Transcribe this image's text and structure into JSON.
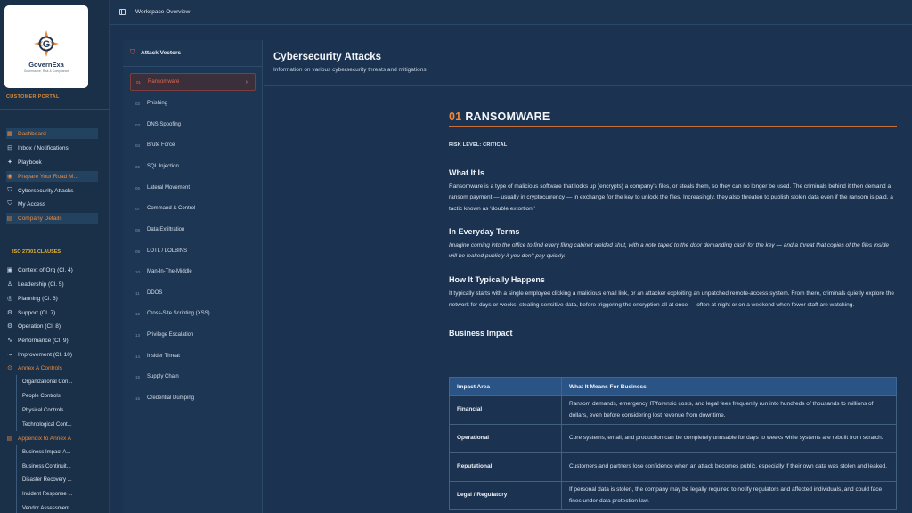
{
  "brand": {
    "name": "GovernExa",
    "tagline": "Governance, Risk & Compliance"
  },
  "sidebar": {
    "portal_label": "CUSTOMER PORTAL",
    "items": [
      {
        "label": "Dashboard",
        "icon": "dashboard-icon"
      },
      {
        "label": "Inbox / Notifications",
        "icon": "inbox-icon"
      },
      {
        "label": "Playbook",
        "icon": "playbook-icon"
      },
      {
        "label": "Prepare Your Road M...",
        "icon": "roadmap-icon"
      },
      {
        "label": "Cybersecurity Attacks",
        "icon": "shield-icon"
      },
      {
        "label": "My Access",
        "icon": "access-icon"
      },
      {
        "label": "Company Details",
        "icon": "building-icon"
      }
    ],
    "iso_label": "ISO 27001 CLAUSES",
    "clauses": [
      {
        "label": "Context of Org (Cl. 4)",
        "icon": "context-icon"
      },
      {
        "label": "Leadership (Cl. 5)",
        "icon": "leadership-icon"
      },
      {
        "label": "Planning (Cl. 6)",
        "icon": "planning-icon"
      },
      {
        "label": "Support (Cl. 7)",
        "icon": "support-icon"
      },
      {
        "label": "Operation (Cl. 8)",
        "icon": "operation-icon"
      },
      {
        "label": "Performance (Cl. 9)",
        "icon": "performance-icon"
      },
      {
        "label": "Improvement (Cl. 10)",
        "icon": "improvement-icon"
      },
      {
        "label": "Annex A Controls",
        "icon": "annex-icon"
      }
    ],
    "annex_sub": [
      "Organizational Con...",
      "People Controls",
      "Physical Controls",
      "Technological Cont..."
    ],
    "appendix_label": "Appendix to Annex A",
    "appendix_sub": [
      "Business Impact A...",
      "Business Continuit...",
      "Disaster Recovery ...",
      "Incident Response ...",
      "Vendor Assessment"
    ]
  },
  "topbar": {
    "title": "Workspace Overview"
  },
  "vectors": {
    "title": "Attack Vectors",
    "items": [
      {
        "num": "01",
        "label": "Ransomware"
      },
      {
        "num": "02",
        "label": "Phishing"
      },
      {
        "num": "03",
        "label": "DNS Spoofing"
      },
      {
        "num": "04",
        "label": "Brute Force"
      },
      {
        "num": "05",
        "label": "SQL Injection"
      },
      {
        "num": "06",
        "label": "Lateral Movement"
      },
      {
        "num": "07",
        "label": "Command & Control"
      },
      {
        "num": "08",
        "label": "Data Exfiltration"
      },
      {
        "num": "09",
        "label": "LOTL / LOLBINS"
      },
      {
        "num": "10",
        "label": "Man-In-The-Middle"
      },
      {
        "num": "11",
        "label": "DDOS"
      },
      {
        "num": "12",
        "label": "Cross-Site Scripting (XSS)"
      },
      {
        "num": "13",
        "label": "Privilege Escalation"
      },
      {
        "num": "14",
        "label": "Insider Threat"
      },
      {
        "num": "15",
        "label": "Supply Chain"
      },
      {
        "num": "16",
        "label": "Credential Dumping"
      }
    ]
  },
  "main": {
    "title": "Cybersecurity Attacks",
    "subtitle": "Information on various cybersecurity threats and mitigations",
    "article": {
      "num": "01",
      "title": "RANSOMWARE",
      "risk": "RISK LEVEL: CRITICAL",
      "what_heading": "What It Is",
      "what_text": "Ransomware is a type of malicious software that locks up (encrypts) a company's files, or steals them, so they can no longer be used. The criminals behind it then demand a ransom payment — usually in cryptocurrency — in exchange for the key to unlock the files. Increasingly, they also threaten to publish stolen data even if the ransom is paid, a tactic known as 'double extortion.'",
      "everyday_heading": "In Everyday Terms",
      "everyday_text": "Imagine coming into the office to find every filing cabinet welded shut, with a note taped to the door demanding cash for the key — and a threat that copies of the files inside will be leaked publicly if you don't pay quickly.",
      "how_heading": "How It Typically Happens",
      "how_text": "It typically starts with a single employee clicking a malicious email link, or an attacker exploiting an unpatched remote-access system. From there, criminals quietly explore the network for days or weeks, stealing sensitive data, before triggering the encryption all at once — often at night or on a weekend when fewer staff are watching.",
      "impact_heading": "Business Impact",
      "impact_cols": [
        "Impact Area",
        "What It Means For Business"
      ],
      "impact_rows": [
        {
          "area": "Financial",
          "text": "Ransom demands, emergency IT/forensic costs, and legal fees frequently run into hundreds of thousands to millions of dollars, even before considering lost revenue from downtime."
        },
        {
          "area": "Operational",
          "text": "Core systems, email, and production can be completely unusable for days to weeks while systems are rebuilt from scratch."
        },
        {
          "area": "Reputational",
          "text": "Customers and partners lose confidence when an attack becomes public, especially if their own data was stolen and leaked."
        },
        {
          "area": "Legal / Regulatory",
          "text": "If personal data is stolen, the company may be legally required to notify regulators and affected individuals, and could face fines under data protection law."
        }
      ]
    }
  }
}
